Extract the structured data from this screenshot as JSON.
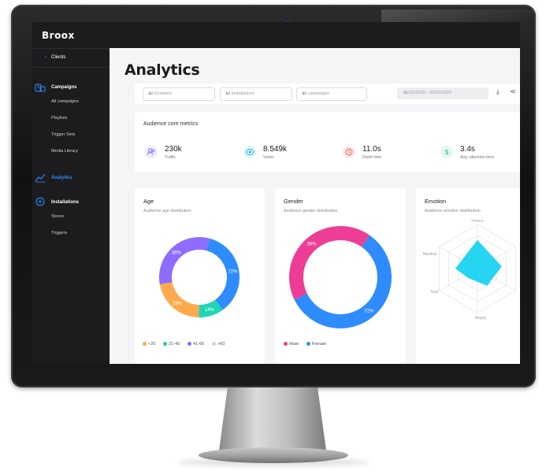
{
  "app": {
    "logo": "Broox"
  },
  "sidebar": {
    "back_label": "Clients",
    "sections": [
      {
        "label": "Campaigns",
        "icon": "campaigns-icon",
        "items": [
          "All campaigns",
          "Playlists",
          "Trigger Sets",
          "Media Library"
        ]
      },
      {
        "label": "Analytics",
        "icon": "analytics-icon",
        "active": true,
        "items": []
      },
      {
        "label": "Installations",
        "icon": "installations-icon",
        "items": [
          "Stores",
          "Triggers"
        ]
      }
    ]
  },
  "page": {
    "title": "Analytics"
  },
  "filters": {
    "locations": "All locations",
    "installations": "All installations",
    "campaigns": "All campaigns",
    "date_range": "06/22/2020 - 06/22/2020"
  },
  "core_metrics": {
    "title": "Audience core metrics",
    "items": [
      {
        "value": "230k",
        "label": "Traffic",
        "icon": "people-icon",
        "color": "#7b61ff"
      },
      {
        "value": "8.549k",
        "label": "Views",
        "icon": "eye-icon",
        "color": "#1fb5c6"
      },
      {
        "value": "11.0s",
        "label": "Dwell time",
        "icon": "clock-icon",
        "color": "#ff4d4d"
      },
      {
        "value": "3.4s",
        "label": "Avg. attention time",
        "icon": "dollar-icon",
        "color": "#2ebd6b"
      }
    ]
  },
  "age_card": {
    "title": "Age",
    "subtitle": "Audience age distribution",
    "slice_labels": [
      "72%",
      "14%",
      "28%",
      "36%"
    ],
    "legend": [
      "<20",
      "21-40",
      "41-60",
      ">60"
    ]
  },
  "gender_card": {
    "title": "Gender",
    "subtitle": "Audience gender distribution",
    "slice_labels": [
      "72%",
      "36%"
    ],
    "legend": [
      "Male",
      "Female"
    ]
  },
  "emotion_card": {
    "title": "Emotion",
    "subtitle": "Audience emotion distribution",
    "axes": [
      "Happy",
      "Neutral",
      "Sad",
      "Angry"
    ]
  },
  "chart_data": [
    {
      "type": "pie",
      "title": "Age",
      "categories": [
        "<20",
        "21-40",
        "41-60",
        ">60"
      ],
      "values": [
        22,
        14,
        28,
        36
      ],
      "data_labels": {
        "41-60": "72%",
        "21-40": "14%",
        "<20": "28%",
        ">60": "36%"
      },
      "colors": [
        "#ffa94d",
        "#20c9b0",
        "#8f6bff",
        "#cfd3da"
      ],
      "slices": [
        {
          "label": "72%",
          "value": 36,
          "color": "#2f8cff"
        },
        {
          "label": "14%",
          "value": 10,
          "color": "#20d6b5"
        },
        {
          "label": "28%",
          "value": 22,
          "color": "#ffa94d"
        },
        {
          "label": "36%",
          "value": 32,
          "color": "#8f6bff"
        }
      ]
    },
    {
      "type": "pie",
      "title": "Gender",
      "categories": [
        "Male",
        "Female"
      ],
      "slices": [
        {
          "label": "72%",
          "value": 58,
          "color": "#2f8cff"
        },
        {
          "label": "36%",
          "value": 42,
          "color": "#ee3d96"
        }
      ],
      "legend_colors": {
        "Male": "#ee3d96",
        "Female": "#2f8cff"
      }
    },
    {
      "type": "radar",
      "title": "Emotion",
      "axes": [
        "Happy",
        "Neutral",
        "Sad",
        "Angry"
      ],
      "values": [
        0.65,
        0.5,
        0.3,
        0.45
      ],
      "color": "#19d3f0"
    }
  ]
}
